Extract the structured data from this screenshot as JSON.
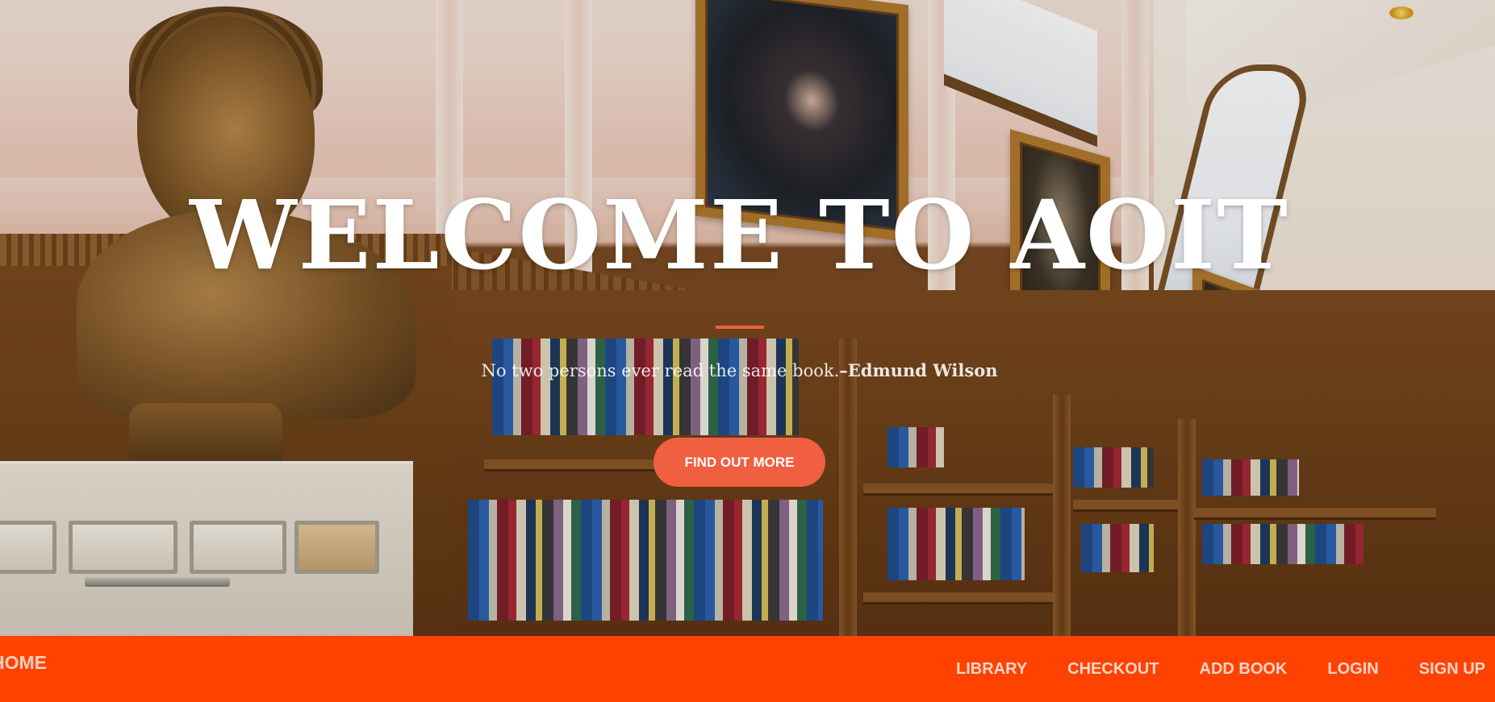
{
  "hero": {
    "title": "WELCOME TO AOIT",
    "quote_text": "No two persons ever read the same book.",
    "quote_author": "–Edmund Wilson",
    "cta_label": "FIND OUT MORE",
    "accent_color": "#f05f40"
  },
  "navbar": {
    "brand_label": "HOME",
    "background_color": "#ff4200",
    "links": [
      {
        "label": "LIBRARY"
      },
      {
        "label": "CHECKOUT"
      },
      {
        "label": "ADD BOOK"
      },
      {
        "label": "LOGIN"
      },
      {
        "label": "SIGN UP"
      }
    ]
  }
}
